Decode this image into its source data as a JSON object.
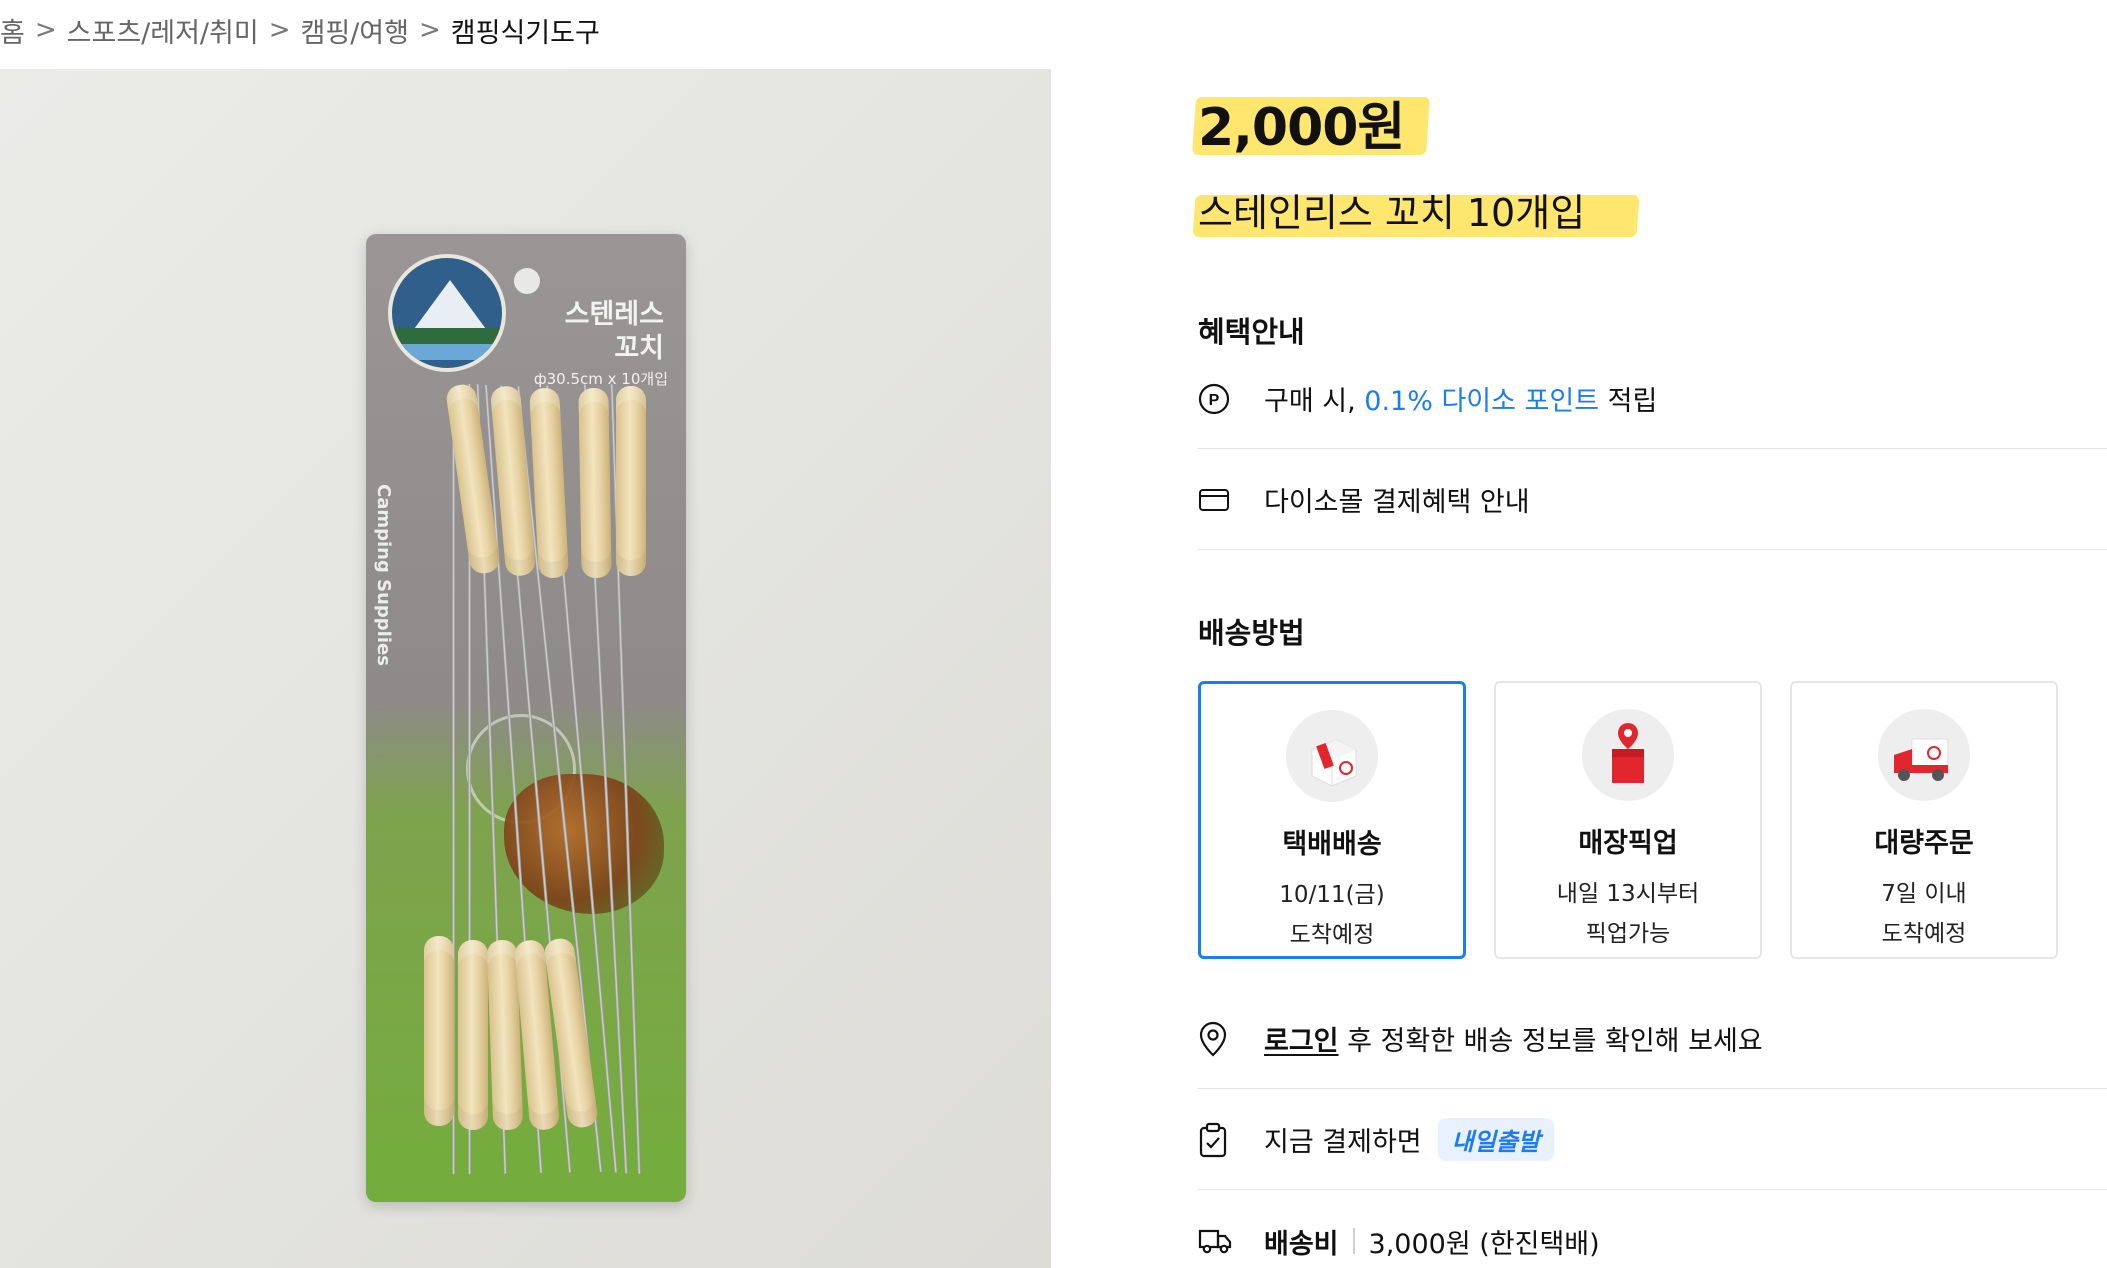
{
  "breadcrumb": {
    "home": "홈",
    "level1": "스포츠/레저/취미",
    "level2": "캠핑/여행",
    "current": "캠핑식기도구",
    "separator": ">"
  },
  "product": {
    "price": "2,000원",
    "name": "스테인리스 꼬치 10개입",
    "image": {
      "package_title": "스텐레스 꼬치",
      "package_spec": "ф30.5cm x 10개입",
      "package_side_text": "Camping Supplies"
    }
  },
  "benefits": {
    "title": "혜택안내",
    "points_prefix": "구매 시, ",
    "points_highlight": "0.1% 다이소 포인트",
    "points_suffix": " 적립",
    "payment_benefit": "다이소몰 결제혜택 안내"
  },
  "shipping": {
    "title": "배송방법",
    "options": [
      {
        "title": "택배배송",
        "line1": "10/11(금)",
        "line2": "도착예정",
        "icon": "parcel-box-icon",
        "selected": true
      },
      {
        "title": "매장픽업",
        "line1": "내일 13시부터",
        "line2": "픽업가능",
        "icon": "store-pickup-icon",
        "selected": false
      },
      {
        "title": "대량주문",
        "line1": "7일 이내",
        "line2": "도착예정",
        "icon": "delivery-truck-icon",
        "selected": false
      }
    ],
    "login_link": "로그인",
    "login_suffix": " 후 정확한 배송 정보를 확인해 보세요",
    "pay_now": "지금 결제하면",
    "pay_now_badge": "내일출발",
    "fee_label": "배송비",
    "fee_value": "3,000원 (한진택배)"
  },
  "colors": {
    "accent_blue": "#1c7df2",
    "highlight_yellow": "#ffe356",
    "divider": "#e5e5e5"
  }
}
